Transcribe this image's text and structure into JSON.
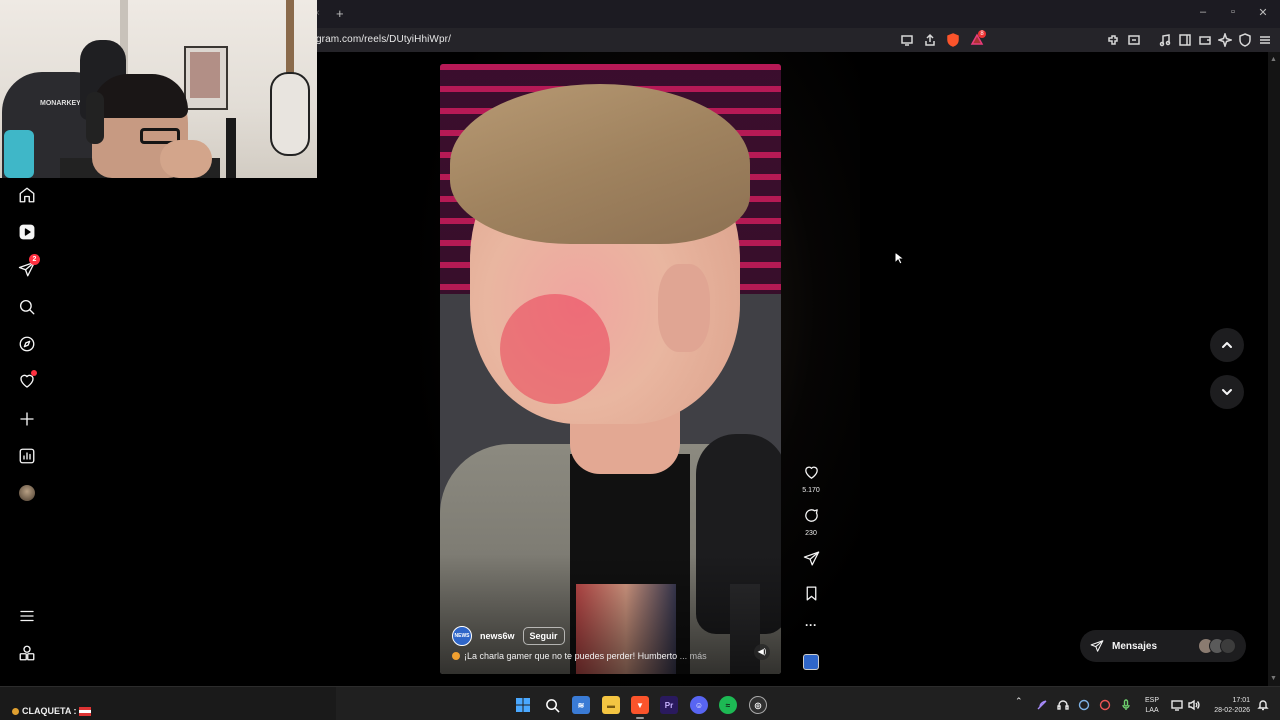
{
  "browser": {
    "url": "gram.com/reels/DUtyiHhiWpr/",
    "new_tab": "+",
    "tab_close": "×",
    "notif_count": "8"
  },
  "webcam": {
    "chair_brand": "MONARKEY"
  },
  "sidebar": {
    "items": [
      {
        "id": "home",
        "icon": "home-icon"
      },
      {
        "id": "reels",
        "icon": "reels-icon"
      },
      {
        "id": "messages",
        "icon": "send-icon",
        "badge": "2"
      },
      {
        "id": "search",
        "icon": "search-icon"
      },
      {
        "id": "explore",
        "icon": "compass-icon"
      },
      {
        "id": "notifications",
        "icon": "heart-icon"
      },
      {
        "id": "create",
        "icon": "plus-icon"
      },
      {
        "id": "dashboard",
        "icon": "chart-icon"
      },
      {
        "id": "profile",
        "icon": "avatar"
      }
    ],
    "bottom": [
      {
        "id": "more",
        "icon": "menu-icon"
      },
      {
        "id": "also-from-meta",
        "icon": "apps-icon"
      }
    ]
  },
  "reel": {
    "author": "news6w",
    "author_avatar_text": "NEWS",
    "follow_label": "Seguir",
    "caption": "¡La charla gamer que no te puedes perder! Humberto",
    "caption_more": "... más",
    "likes": "5.170",
    "comments": "230"
  },
  "messages_pill": {
    "label": "Mensajes"
  },
  "taskbar": {
    "status_label": "CLAQUETA :",
    "lang_top": "ESP",
    "lang_bottom": "LAA",
    "time": "17:01",
    "date": "28-02-2026",
    "apps": [
      {
        "name": "windows-start",
        "color": "#4aa8ff"
      },
      {
        "name": "search",
        "color": "#202020"
      },
      {
        "name": "widgets",
        "color": "#3a7bd5"
      },
      {
        "name": "file-explorer",
        "color": "#f4c542"
      },
      {
        "name": "brave",
        "color": "#fb542b"
      },
      {
        "name": "premiere",
        "color": "#2a1a5e",
        "label": "Pr"
      },
      {
        "name": "discord",
        "color": "#5865f2"
      },
      {
        "name": "spotify",
        "color": "#1db954"
      },
      {
        "name": "obs",
        "color": "#303030"
      }
    ]
  }
}
